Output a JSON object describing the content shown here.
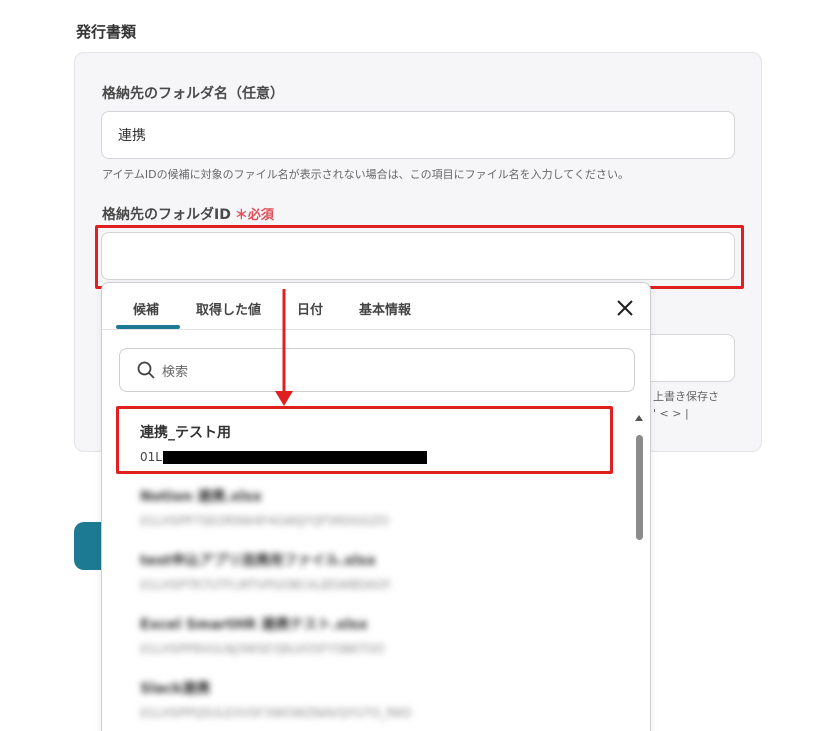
{
  "section": {
    "title": "発行書類"
  },
  "folder_name": {
    "label": "格納先のフォルダ名（任意）",
    "value": "連携",
    "hint": "アイテムIDの候補に対象のファイル名が表示されない場合は、この項目にファイル名を入力してください。"
  },
  "folder_id": {
    "label": "格納先のフォルダID",
    "required_label": "＊必須",
    "value": ""
  },
  "background": {
    "hint_line1": "上書き保存さ",
    "hint_line2": "' < > |"
  },
  "picker": {
    "tabs": [
      {
        "label": "候補",
        "active": true
      },
      {
        "label": "取得した値",
        "active": false
      },
      {
        "label": "日付",
        "active": false
      },
      {
        "label": "基本情報",
        "active": false
      }
    ],
    "search_placeholder": "検索",
    "items": [
      {
        "name": "連携_テスト用",
        "id_prefix": "01L",
        "id_redacted": true,
        "blurred": false
      },
      {
        "name": "Notion 連携.xlsx",
        "id": "01LH5PP7SEOR9W4F4GWIJYQF5RDGGZO",
        "blurred": true
      },
      {
        "name": "test申込アプリ连携用ファイル.xlsx",
        "id": "01LH5PTR7UTFLMTVPGOBCALB5WBDAOY",
        "blurred": true
      },
      {
        "name": "Excel SmartHR 連携テスト.xlsx",
        "id": "01LH5PP8VULNJ3W5EYJ6LVO5FY5B6TOO",
        "blurred": true
      },
      {
        "name": "Slack連携",
        "id": "01LH5PPQ5ULEXV5F3WOWZNAVQYU7O_RKO",
        "blurred": true
      }
    ]
  },
  "colors": {
    "accent": "#1c7a92",
    "highlight": "#e02020",
    "required": "#e0505a"
  }
}
